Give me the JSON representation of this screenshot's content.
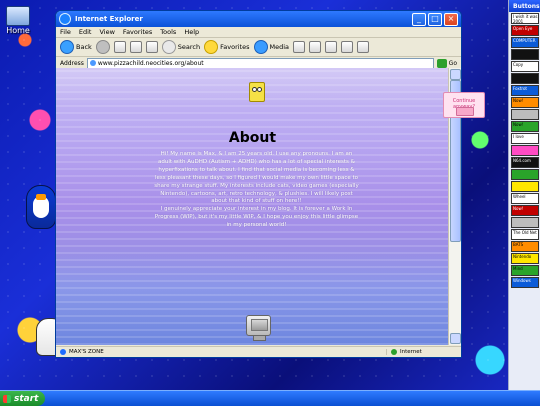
{
  "desktop": {
    "icons": [
      {
        "label": "Home",
        "icon": "my-computer-icon"
      },
      {
        "label": "",
        "icon": "penguin-icon"
      },
      {
        "label": "",
        "icon": "cat-icon"
      }
    ]
  },
  "browser": {
    "title": "Internet Explorer",
    "menu": [
      "File",
      "Edit",
      "View",
      "Favorites",
      "Tools",
      "Help"
    ],
    "toolbar": {
      "back": "Back",
      "search": "Search",
      "favorites": "Favorites",
      "media": "Media"
    },
    "address": {
      "label": "Address",
      "url": "www.pizzachild.neocities.org/about",
      "go": "Go"
    },
    "page": {
      "heading": "About",
      "paragraph": "Hi! My name is Max, & I am 25 years old. I use any pronouns. I am an adult with AuDHD (Autism + ADHD) who has a lot of special interests & hyperfixations to talk about. I find that social media is becoming less & less pleasant these days, so I figured I would make my own little space to share my strange stuff. My interests include cats, video games (especially Nintendo), cartoons, art, retro technology, & plushies. I will likely post about that kind of stuff on here!!\nI genuinely appreciate your interest in my blog. It is forever a Work In Progress (WIP), but it's my little WIP, & I hope you enjoy this little glimpse in my personal world!"
    },
    "status": {
      "left": "MAX'S ZONE",
      "right": "Internet"
    }
  },
  "popup": {
    "message": "Continue anyway?"
  },
  "sidebar": {
    "title": "Buttons",
    "badges": [
      {
        "text": "I wish it was 2001",
        "color": "#ffffff"
      },
      {
        "text": "Open Eye",
        "color": "#c10000"
      },
      {
        "text": "COMPUTER",
        "color": "#0b5bd8"
      },
      {
        "text": "",
        "color": "#111111"
      },
      {
        "text": "Copy",
        "color": "#ffffff"
      },
      {
        "text": "",
        "color": "#111111"
      },
      {
        "text": "Foxtrot",
        "color": "#0b5bd8"
      },
      {
        "text": "Now!",
        "color": "#ff8c00"
      },
      {
        "text": "",
        "color": "#bdbdbd"
      },
      {
        "text": "Now!",
        "color": "#2aa42a"
      },
      {
        "text": "I love",
        "color": "#ffffff"
      },
      {
        "text": "",
        "color": "#ff4bc4"
      },
      {
        "text": "N64.com",
        "color": "#111111"
      },
      {
        "text": "",
        "color": "#2aa42a"
      },
      {
        "text": "",
        "color": "#ffe600"
      },
      {
        "text": "Wheel",
        "color": "#ffffff"
      },
      {
        "text": "Now!",
        "color": "#c10000"
      },
      {
        "text": "",
        "color": "#bdbdbd"
      },
      {
        "text": "The Old Net",
        "color": "#ffffff"
      },
      {
        "text": "BATS",
        "color": "#ff8c00"
      },
      {
        "text": "Nintendo",
        "color": "#ffe600"
      },
      {
        "text": "Mind",
        "color": "#2aa42a"
      },
      {
        "text": "Windows",
        "color": "#0b5bd8"
      }
    ]
  },
  "taskbar": {
    "start_label": "start"
  }
}
